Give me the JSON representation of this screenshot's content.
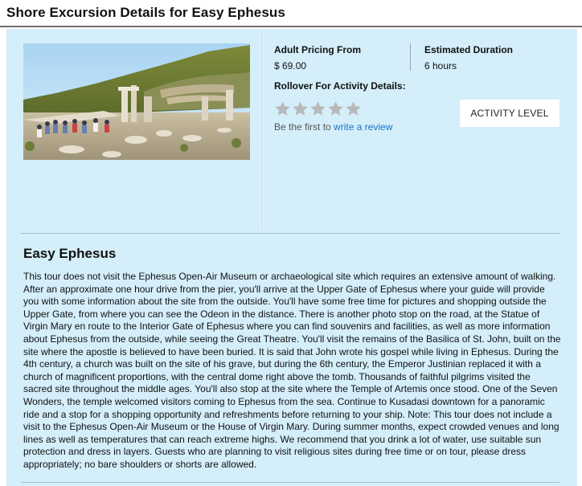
{
  "page": {
    "title": "Shore Excursion Details for Easy Ephesus"
  },
  "excursion": {
    "photo_alt": "Ruins of Ephesus",
    "pricing_label": "Adult Pricing From",
    "pricing_value": "$ 69.00",
    "duration_label": "Estimated Duration",
    "duration_value": "6 hours",
    "rollover_label": "Rollover For Activity Details:",
    "rating": {
      "value": 0,
      "max": 5,
      "filled_color": "#f2b01e",
      "empty_color": "#b9b9b9"
    },
    "review_prefix": "Be the first to ",
    "review_link": "write a review",
    "activity_button": "ACTIVITY LEVEL"
  },
  "description": {
    "title": "Easy Ephesus",
    "body": "This tour does not visit the Ephesus Open-Air Museum or archaeological site which requires an extensive amount of walking. After an approximate one hour drive from the pier, you'll arrive at the Upper Gate of Ephesus where your guide will provide you with some information about the site from the outside. You'll have some free time for pictures and shopping outside the Upper Gate, from where you can see the Odeon in the distance. There is another photo stop on the road, at the Statue of Virgin Mary en route to the Interior Gate of Ephesus where you can find souvenirs and facilities, as well as more information about Ephesus from the outside, while seeing the Great Theatre. You'll visit the remains of the Basilica of St. John, built on the site where the apostle is believed to have been buried. It is said that John wrote his gospel while living in Ephesus. During the 4th century, a church was built on the site of his grave, but during the 6th century, the Emperor Justinian replaced it with a church of magnificent proportions, with the central dome right above the tomb. Thousands of faithful pilgrims visited the sacred site throughout the middle ages. You'll also stop at the site where the Temple of Artemis once stood. One of the Seven Wonders, the temple welcomed visitors coming to Ephesus from the sea. Continue to Kusadasi downtown for a panoramic ride and a stop for a shopping opportunity and refreshments before returning to your ship. Note: This tour does not include a visit to the Ephesus Open-Air Museum or the House of Virgin Mary. During summer months, expect crowded venues and long lines as well as temperatures that can reach extreme highs. We recommend that you drink a lot of water, use suitable sun protection and dress in layers. Guests who are planning to visit religious sites during free time or on tour, please dress appropriately; no bare shoulders or shorts are allowed."
  }
}
